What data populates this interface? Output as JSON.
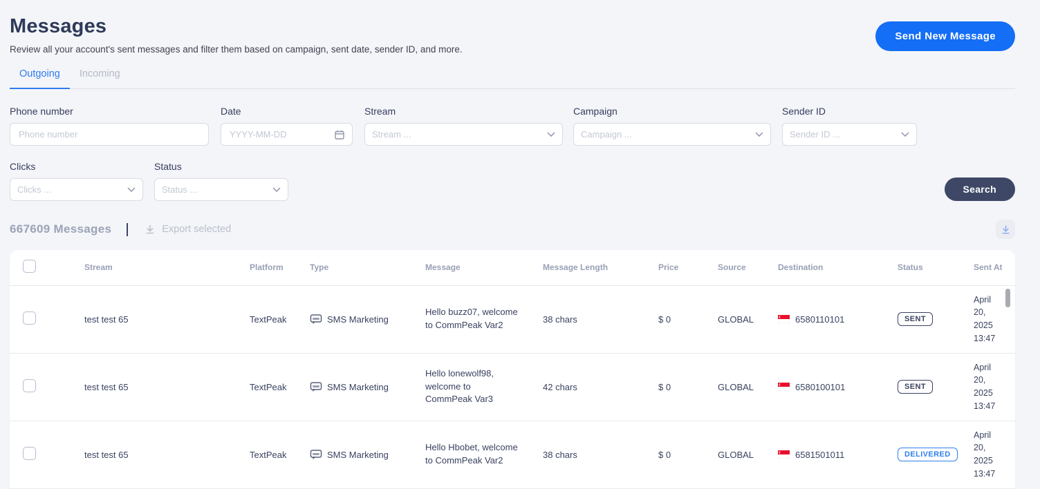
{
  "header": {
    "title": "Messages",
    "subtitle": "Review all your account's sent messages and filter them based on campaign, sent date, sender ID, and more.",
    "send_button": "Send New Message"
  },
  "tabs": {
    "outgoing": "Outgoing",
    "incoming": "Incoming"
  },
  "filters": {
    "phone": {
      "label": "Phone number",
      "placeholder": "Phone number"
    },
    "date": {
      "label": "Date",
      "placeholder": "YYYY-MM-DD"
    },
    "stream": {
      "label": "Stream",
      "placeholder": "Stream ..."
    },
    "campaign": {
      "label": "Campaign",
      "placeholder": "Campaign ..."
    },
    "sender_id": {
      "label": "Sender ID",
      "placeholder": "Sender ID ..."
    },
    "clicks": {
      "label": "Clicks",
      "placeholder": "Clicks ..."
    },
    "status": {
      "label": "Status",
      "placeholder": "Status ..."
    },
    "search_button": "Search"
  },
  "results": {
    "count": "667609 Messages",
    "export_label": "Export selected"
  },
  "table": {
    "columns": {
      "stream": "Stream",
      "platform": "Platform",
      "type": "Type",
      "message": "Message",
      "message_length": "Message Length",
      "price": "Price",
      "source": "Source",
      "destination": "Destination",
      "status": "Status",
      "sent_at": "Sent At"
    },
    "rows": [
      {
        "stream": "test test 65",
        "platform": "TextPeak",
        "type": "SMS Marketing",
        "message": "Hello buzz07, welcome to CommPeak Var2",
        "message_length": "38 chars",
        "price": "$ 0",
        "source": "GLOBAL",
        "destination": "6580110101",
        "status": "SENT",
        "sent_at": "April 20, 2025 13:47"
      },
      {
        "stream": "test test 65",
        "platform": "TextPeak",
        "type": "SMS Marketing",
        "message": "Hello lonewolf98, welcome to CommPeak Var3",
        "message_length": "42 chars",
        "price": "$ 0",
        "source": "GLOBAL",
        "destination": "6580100101",
        "status": "SENT",
        "sent_at": "April 20, 2025 13:47"
      },
      {
        "stream": "test test 65",
        "platform": "TextPeak",
        "type": "SMS Marketing",
        "message": "Hello Hbobet, welcome to CommPeak Var2",
        "message_length": "38 chars",
        "price": "$ 0",
        "source": "GLOBAL",
        "destination": "6581501011",
        "status": "DELIVERED",
        "sent_at": "April 20, 2025 13:47"
      }
    ]
  },
  "colors": {
    "accent_blue": "#146ef6",
    "active_tab_blue": "#2f7bf0",
    "navy": "#39425f",
    "delivered_blue": "#2f80ed",
    "search_button_navy": "#3e4866",
    "flag_red": "#e8112d"
  }
}
